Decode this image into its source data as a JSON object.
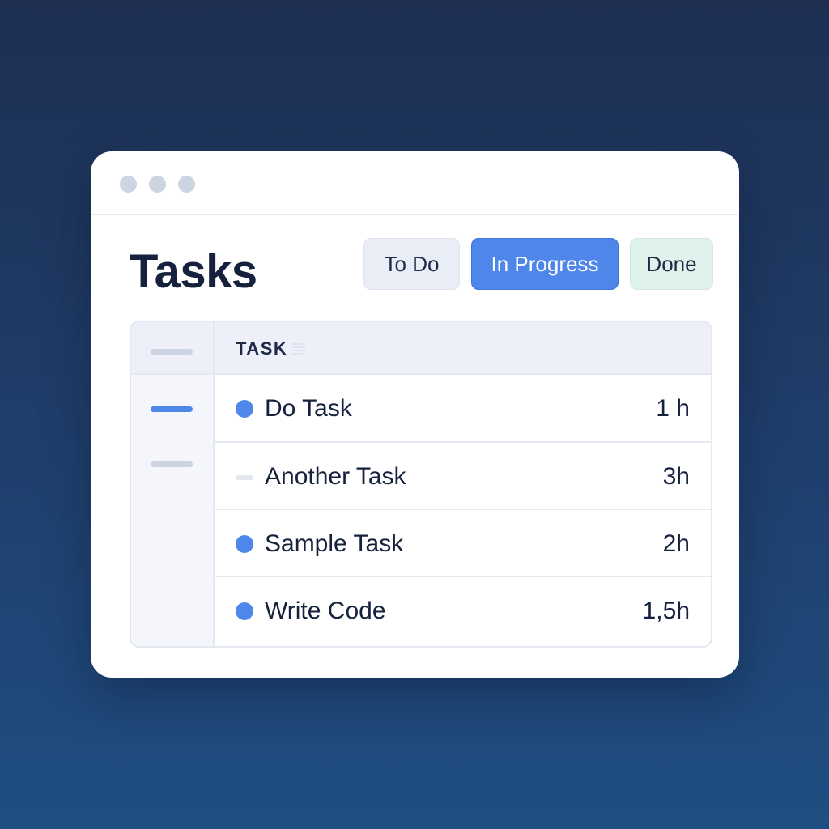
{
  "window": {
    "controls": [
      "window-dot",
      "window-dot",
      "window-dot"
    ]
  },
  "header": {
    "title": "Tasks"
  },
  "tabs": [
    {
      "label": "To Do",
      "active": false
    },
    {
      "label": "In Progress",
      "active": true
    },
    {
      "label": "Done",
      "active": false
    }
  ],
  "table": {
    "column_header": "TASK",
    "rows": [
      {
        "name": "Do Task",
        "time": "1 h",
        "marker": "dot"
      },
      {
        "name": "Another Task",
        "time": "3h",
        "marker": "dash"
      },
      {
        "name": "Sample Task",
        "time": "2h",
        "marker": "dot"
      },
      {
        "name": "Write Code",
        "time": "1,5h",
        "marker": "dot"
      }
    ]
  },
  "colors": {
    "accent": "#4f86ea",
    "done_tab": "#dff3ec",
    "todo_tab": "#e9edf6",
    "text": "#16213d",
    "background_top": "#1e2f52",
    "background_bottom": "#1f4e82"
  }
}
